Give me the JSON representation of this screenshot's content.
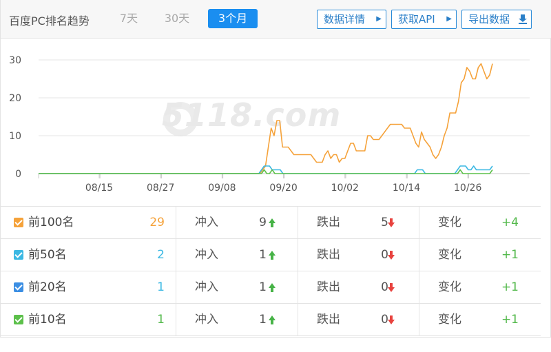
{
  "header": {
    "title": "百度PC排名趋势",
    "tabs": [
      {
        "label": "7天",
        "active": false
      },
      {
        "label": "30天",
        "active": false
      },
      {
        "label": "3个月",
        "active": true
      }
    ],
    "buttons": {
      "detail": "数据详情",
      "api": "获取API",
      "export": "导出数据"
    }
  },
  "watermark": "5118.com",
  "colors": {
    "top100": "#f5a23a",
    "top50": "#3bb8e3",
    "top20": "#3b8ee3",
    "top10": "#5cc04a",
    "accent": "#1a8ef0"
  },
  "chart_data": {
    "type": "line",
    "ylim": [
      0,
      30
    ],
    "yticks": [
      "0",
      "10",
      "20",
      "30"
    ],
    "xticks": [
      "08/15",
      "08/27",
      "09/08",
      "09/20",
      "10/02",
      "10/14",
      "10/26"
    ],
    "grid": true,
    "series": [
      {
        "name": "前100名",
        "color": "#f5a23a",
        "values": [
          0,
          0,
          0,
          0,
          0,
          0,
          0,
          0,
          0,
          0,
          0,
          0,
          0,
          0,
          0,
          0,
          0,
          0,
          0,
          0,
          0,
          0,
          0,
          0,
          0,
          0,
          0,
          0,
          0,
          0,
          0,
          0,
          0,
          0,
          0,
          0,
          0,
          0,
          0,
          0,
          0,
          0,
          0,
          0,
          0,
          0,
          0,
          0,
          0,
          0,
          0,
          0,
          0,
          0,
          0,
          0,
          0,
          0,
          0,
          0,
          0,
          0,
          0,
          0,
          0,
          0,
          0,
          0,
          0,
          0,
          0,
          0,
          0,
          0,
          0,
          0,
          0,
          0,
          0,
          1,
          2,
          7,
          12,
          10,
          14,
          14,
          7,
          7,
          7,
          6,
          5,
          5,
          5,
          5,
          5,
          5,
          5,
          4,
          3,
          3,
          3,
          5,
          6,
          4,
          5,
          5,
          3,
          4,
          4,
          6,
          8,
          8,
          6,
          6,
          6,
          6,
          10,
          10,
          9,
          9,
          9,
          10,
          11,
          12,
          13,
          13,
          13,
          13,
          13,
          12,
          12,
          12,
          10,
          8,
          7,
          11,
          9,
          8,
          7,
          5,
          4,
          5,
          7,
          10,
          12,
          16,
          16,
          16,
          19,
          24,
          25,
          28,
          27,
          25,
          25,
          28,
          29,
          27,
          25,
          26,
          29
        ]
      },
      {
        "name": "前50名",
        "color": "#3bb8e3",
        "values": [
          0,
          0,
          0,
          0,
          0,
          0,
          0,
          0,
          0,
          0,
          0,
          0,
          0,
          0,
          0,
          0,
          0,
          0,
          0,
          0,
          0,
          0,
          0,
          0,
          0,
          0,
          0,
          0,
          0,
          0,
          0,
          0,
          0,
          0,
          0,
          0,
          0,
          0,
          0,
          0,
          0,
          0,
          0,
          0,
          0,
          0,
          0,
          0,
          0,
          0,
          0,
          0,
          0,
          0,
          0,
          0,
          0,
          0,
          0,
          0,
          0,
          0,
          0,
          0,
          0,
          0,
          0,
          0,
          0,
          0,
          0,
          0,
          0,
          0,
          0,
          0,
          0,
          0,
          0,
          0,
          0,
          0,
          0,
          1,
          2,
          2,
          2,
          1,
          1,
          1,
          1,
          0,
          0,
          0,
          0,
          0,
          0,
          0,
          0,
          0,
          0,
          0,
          0,
          0,
          0,
          0,
          0,
          0,
          0,
          0,
          0,
          0,
          0,
          0,
          0,
          0,
          0,
          0,
          0,
          0,
          0,
          0,
          0,
          0,
          0,
          0,
          0,
          0,
          0,
          0,
          0,
          0,
          0,
          0,
          0,
          0,
          0,
          0,
          0,
          0,
          0,
          1,
          1,
          1,
          0,
          0,
          0,
          0,
          0,
          0,
          0,
          0,
          0,
          0,
          0,
          0,
          1,
          2,
          2,
          2,
          1,
          1,
          2,
          1,
          1,
          1,
          1,
          1,
          1,
          2
        ]
      },
      {
        "name": "前10名",
        "color": "#5cc04a",
        "values": [
          0,
          0,
          0,
          0,
          0,
          0,
          0,
          0,
          0,
          0,
          0,
          0,
          0,
          0,
          0,
          0,
          0,
          0,
          0,
          0,
          0,
          0,
          0,
          0,
          0,
          0,
          0,
          0,
          0,
          0,
          0,
          0,
          0,
          0,
          0,
          0,
          0,
          0,
          0,
          0,
          0,
          0,
          0,
          0,
          0,
          0,
          0,
          0,
          0,
          0,
          0,
          0,
          0,
          0,
          0,
          0,
          0,
          0,
          0,
          0,
          0,
          0,
          0,
          0,
          0,
          0,
          0,
          0,
          0,
          0,
          0,
          0,
          0,
          0,
          0,
          0,
          0,
          0,
          0,
          0,
          0,
          0,
          0,
          0,
          1,
          0,
          0,
          1,
          0,
          0,
          0,
          0,
          0,
          0,
          0,
          0,
          0,
          0,
          0,
          0,
          0,
          0,
          0,
          0,
          0,
          0,
          0,
          0,
          0,
          0,
          0,
          0,
          0,
          0,
          0,
          0,
          0,
          0,
          0,
          0,
          0,
          0,
          0,
          0,
          0,
          0,
          0,
          0,
          0,
          0,
          0,
          0,
          0,
          0,
          0,
          0,
          0,
          0,
          0,
          0,
          0,
          0,
          0,
          0,
          0,
          0,
          0,
          0,
          0,
          0,
          0,
          0,
          0,
          0,
          0,
          0,
          0,
          1,
          0,
          0,
          0,
          0,
          0,
          0,
          0,
          0,
          0,
          0,
          0,
          1
        ]
      }
    ]
  },
  "stats": {
    "in_label": "冲入",
    "out_label": "跌出",
    "change_label": "变化",
    "rows": [
      {
        "label": "前100名",
        "value": "29",
        "color": "#f5a23a",
        "in": "9",
        "out": "5",
        "change": "+4"
      },
      {
        "label": "前50名",
        "value": "2",
        "color": "#3bb8e3",
        "in": "1",
        "out": "0",
        "change": "+1"
      },
      {
        "label": "前20名",
        "value": "1",
        "color": "#3b8ee3",
        "in": "1",
        "out": "0",
        "change": "+1"
      },
      {
        "label": "前10名",
        "value": "1",
        "color": "#5cc04a",
        "in": "1",
        "out": "0",
        "change": "+1"
      }
    ]
  }
}
